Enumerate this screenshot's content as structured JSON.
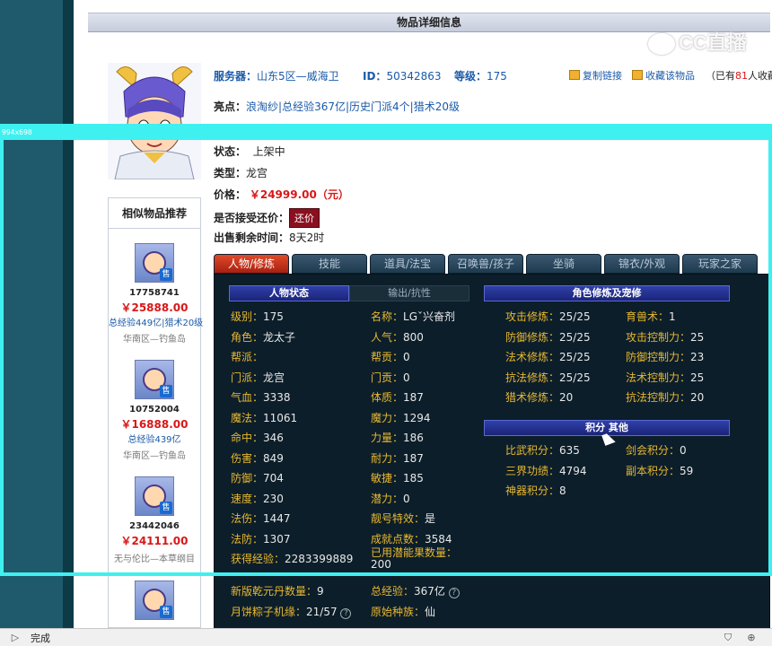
{
  "page_title": "物品详细信息",
  "watermark": "CC直播",
  "meta": {
    "server_label": "服务器：",
    "server_value": "山东5区—威海卫",
    "id_label": "ID：",
    "id_value": "50342863",
    "level_label": "等级：",
    "level_value": "175",
    "copy_link": "复制链接",
    "favorite": "收藏该物品",
    "fav_count_prefix": "（已有",
    "fav_count": "81",
    "fav_count_suffix": "人收藏）"
  },
  "highlights": {
    "label": "亮点：",
    "items": [
      "浪淘纱",
      "|总经验367亿",
      "|历史门派4个",
      "|猎术20级"
    ]
  },
  "status": {
    "label": "状态：",
    "value": "上架中"
  },
  "type": {
    "label": "类型：",
    "value": "龙宫"
  },
  "price": {
    "label": "价格：",
    "value": "￥24999.00（元）"
  },
  "counter_offer": {
    "label": "是否接受还价：",
    "button": "还价"
  },
  "remaining": {
    "label": "出售剩余时间：",
    "value": "8天2时"
  },
  "similar": {
    "title": "相似物品推荐",
    "items": [
      {
        "id": "17758741",
        "price": "￥25888.00",
        "highlights": "总经验449亿|猎术20级",
        "server": "华南区—钓鱼岛",
        "badge": "售"
      },
      {
        "id": "10752004",
        "price": "￥16888.00",
        "highlights": "总经验439亿",
        "server": "华南区—钓鱼岛",
        "badge": "售"
      },
      {
        "id": "23442046",
        "price": "￥24111.00",
        "highlights": "",
        "server": "无与伦比—本草纲目",
        "badge": "售"
      },
      {
        "id": "",
        "price": "",
        "highlights": "",
        "server": "",
        "badge": "售"
      }
    ]
  },
  "tabs": [
    "人物/修炼",
    "技能",
    "道具/法宝",
    "召唤兽/孩子",
    "坐骑",
    "锦衣/外观",
    "玩家之家"
  ],
  "sections": {
    "char_status": "人物状态",
    "output_resist": "输出/抗性",
    "cultivation": "角色修炼及宠修",
    "points_other": "积分 其他"
  },
  "stats_left": [
    [
      "级别：",
      "175"
    ],
    [
      "角色：",
      "龙太子"
    ],
    [
      "帮派：",
      ""
    ],
    [
      "门派：",
      "龙宫"
    ],
    [
      "气血：",
      "3338"
    ],
    [
      "魔法：",
      "11061"
    ],
    [
      "命中：",
      "346"
    ],
    [
      "伤害：",
      "849"
    ],
    [
      "防御：",
      "704"
    ],
    [
      "速度：",
      "230"
    ],
    [
      "法伤：",
      "1447"
    ],
    [
      "法防：",
      "1307"
    ],
    [
      "获得经验：",
      "2283399889"
    ]
  ],
  "stats_mid": [
    [
      "名称：",
      "LGˇ兴奋剂"
    ],
    [
      "人气：",
      "800"
    ],
    [
      "帮贡：",
      "0"
    ],
    [
      "门贡：",
      "0"
    ],
    [
      "体质：",
      "187"
    ],
    [
      "魔力：",
      "1294"
    ],
    [
      "力量：",
      "186"
    ],
    [
      "耐力：",
      "187"
    ],
    [
      "敏捷：",
      "185"
    ],
    [
      "潜力：",
      "0"
    ],
    [
      "靓号特效：",
      "是"
    ],
    [
      "成就点数：",
      "3584"
    ],
    [
      "已用潜能果数量：",
      "200"
    ]
  ],
  "cultivation_left": [
    [
      "攻击修炼：",
      "25/25"
    ],
    [
      "防御修炼：",
      "25/25"
    ],
    [
      "法术修炼：",
      "25/25"
    ],
    [
      "抗法修炼：",
      "25/25"
    ],
    [
      "猎术修炼：",
      "20"
    ]
  ],
  "cultivation_right": [
    [
      "育兽术：",
      "1"
    ],
    [
      "攻击控制力：",
      "25"
    ],
    [
      "防御控制力：",
      "23"
    ],
    [
      "法术控制力：",
      "25"
    ],
    [
      "抗法控制力：",
      "20"
    ]
  ],
  "points_left": [
    [
      "比武积分：",
      "635"
    ],
    [
      "三界功绩：",
      "4794"
    ],
    [
      "神器积分：",
      "8"
    ]
  ],
  "points_right": [
    [
      "剑会积分：",
      "0"
    ],
    [
      "副本积分：",
      "59"
    ]
  ],
  "extra": {
    "qiankun_label": "新版乾元丹数量：",
    "qiankun_value": "9",
    "total_exp_label": "总经验：",
    "total_exp_value": "367亿",
    "zongzi_label": "月饼粽子机缘：",
    "zongzi_value": "21/57",
    "race_label": "原始种族：",
    "race_value": "仙"
  },
  "overlay_label": "994x698",
  "status_bar": {
    "text": "完成"
  }
}
